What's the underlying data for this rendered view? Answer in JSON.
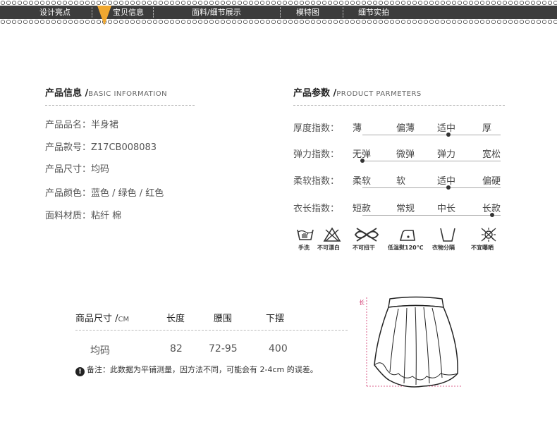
{
  "nav": {
    "items": [
      "设计亮点",
      "宝贝信息",
      "面料/细节展示",
      "模特图",
      "细节实拍"
    ],
    "active_index": 1,
    "accent": "#f0a830"
  },
  "basic_info": {
    "title": "产品信息 /",
    "title_en": "BASIC INFORMATION",
    "rows": [
      "产品品名：半身裙",
      "产品款号：Z17CB008083",
      "产品尺寸：均码",
      "产品颜色：蓝色 / 绿色 / 红色",
      "面料材质：粘纤  棉"
    ]
  },
  "params": {
    "title": "产品参数 /",
    "title_en": "PRODUCT PARMETERS",
    "rows": [
      {
        "label": "厚度指数：",
        "options": [
          "薄",
          "偏薄",
          "适中",
          "厚"
        ],
        "selected_index": 2
      },
      {
        "label": "弹力指数：",
        "options": [
          "无弹",
          "微弹",
          "弹力",
          "宽松"
        ],
        "selected_index": 0
      },
      {
        "label": "柔软指数：",
        "options": [
          "柔软",
          "软",
          "适中",
          "偏硬"
        ],
        "selected_index": 2
      },
      {
        "label": "衣长指数：",
        "options": [
          "短款",
          "常规",
          "中长",
          "长款"
        ],
        "selected_index": 3
      }
    ]
  },
  "care": {
    "items": [
      {
        "label": "手洗",
        "icon": "hand-wash-icon"
      },
      {
        "label": "不可漂白",
        "icon": "no-bleach-icon"
      },
      {
        "label": "不可扭干",
        "icon": "no-wring-icon"
      },
      {
        "label": "低温熨120℃",
        "icon": "iron-low-icon"
      },
      {
        "label": "衣物分隔",
        "icon": "separate-wash-icon"
      },
      {
        "label": "不宜曝晒",
        "icon": "no-sun-icon"
      }
    ]
  },
  "size_table": {
    "title": "商品尺寸 /",
    "unit": "CM",
    "headers": [
      "长度",
      "腰围",
      "下摆"
    ],
    "row": [
      "均码",
      "82",
      "72-95",
      "400"
    ],
    "note": "备注：此数据为平铺测量，因方法不同，可能会有 2-4cm 的误差。"
  },
  "diagram": {
    "length_label": "长",
    "accent": "#d0306a"
  }
}
